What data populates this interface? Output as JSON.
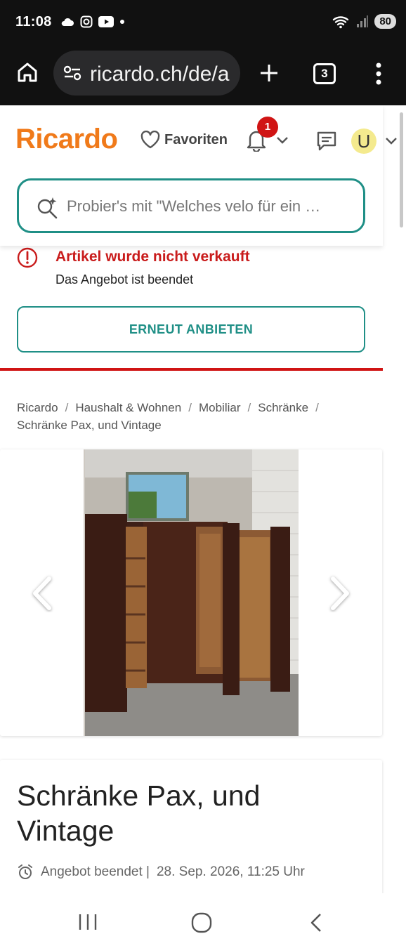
{
  "status_bar": {
    "time": "11:08",
    "battery": "80"
  },
  "browser": {
    "url": "ricardo.ch/de/a",
    "tab_count": "3"
  },
  "header": {
    "logo": "Ricardo",
    "favorites_label": "Favoriten",
    "notification_count": "1",
    "avatar_letter": "U"
  },
  "search": {
    "placeholder": "Probier's mit \"Welches velo für ein …"
  },
  "alert": {
    "title": "Artikel wurde nicht verkauft",
    "subtitle": "Das Angebot ist beendet",
    "color": "#c91c1c"
  },
  "reoffer_button": "ERNEUT ANBIETEN",
  "breadcrumb": [
    "Ricardo",
    "Haushalt & Wohnen",
    "Mobiliar",
    "Schränke",
    "Schränke Pax, und Vintage"
  ],
  "product": {
    "title": "Schränke Pax, und Vintage",
    "status": "Angebot beendet |",
    "end_date": "28. Sep. 2026, 11:25 Uhr"
  },
  "colors": {
    "brand": "#f07a1a",
    "accent": "#1f8f86",
    "danger": "#d01414"
  },
  "icons": [
    "home-icon",
    "site-settings-icon",
    "plus-icon",
    "more-vert-icon",
    "heart-icon",
    "bell-icon",
    "chevron-down-icon",
    "chat-icon",
    "ai-search-icon",
    "error-icon",
    "arrow-left-icon",
    "arrow-right-icon",
    "alarm-icon"
  ]
}
